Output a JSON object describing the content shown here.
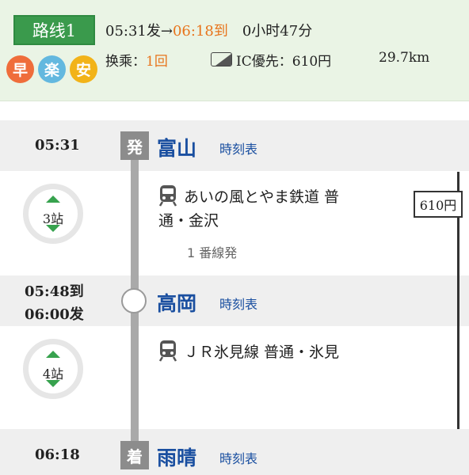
{
  "header": {
    "route_label": "路线1",
    "depart": "05:31发",
    "arrow": "→",
    "arrive": "06:18到",
    "duration": "0小时47分",
    "badges": [
      {
        "label": "早",
        "icon": "fast-icon",
        "color": "#ef6d3b"
      },
      {
        "label": "楽",
        "icon": "easy-icon",
        "color": "#63b8df"
      },
      {
        "label": "安",
        "icon": "cheap-icon",
        "color": "#f2b319"
      }
    ],
    "transfer_prefix": "换乘：",
    "transfer_count": "1回",
    "ic_label": "IC優先：610円",
    "distance": "29.7km"
  },
  "stations": [
    {
      "time": "05:31",
      "tag": "発",
      "name": "富山",
      "timetable": "時刻表"
    },
    {
      "time_arrive": "05:48到",
      "time_depart": "06:00发",
      "name": "高岡",
      "timetable": "時刻表"
    },
    {
      "time": "06:18",
      "tag": "着",
      "name": "雨晴",
      "timetable": "時刻表"
    }
  ],
  "segments": [
    {
      "stops": "3站",
      "line_1": "あいの風とやま鉄道 普",
      "line_2": "通・金沢",
      "platform": "1 番線発",
      "icon": "train-icon"
    },
    {
      "stops": "4站",
      "line_1": "ＪＲ氷見線 普通・氷見",
      "icon": "train-icon"
    }
  ],
  "fare": "610円",
  "colors": {
    "accent": "#3a9a4c",
    "link": "#1a4fa0",
    "highlight": "#e8741c"
  }
}
